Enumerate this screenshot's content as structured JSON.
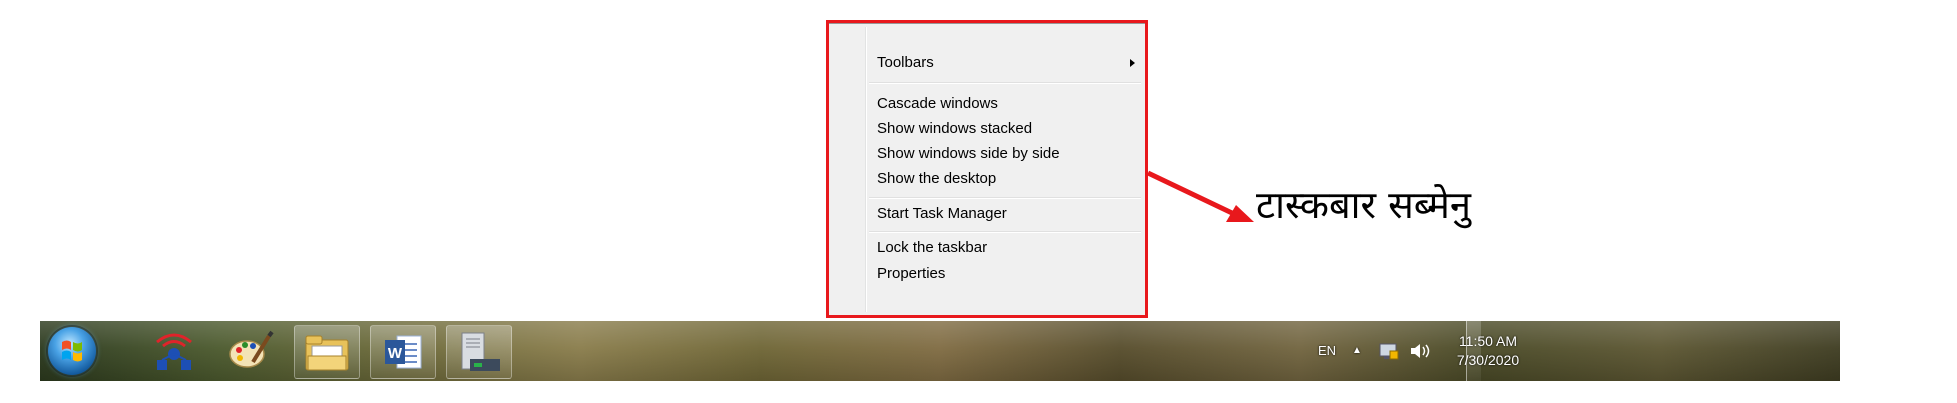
{
  "context_menu": {
    "items": {
      "toolbars": "Toolbars",
      "cascade": "Cascade windows",
      "stacked": "Show windows stacked",
      "side_by_side": "Show windows side by side",
      "desktop": "Show the desktop",
      "task_manager": "Start Task Manager",
      "lock": "Lock the taskbar",
      "properties": "Properties"
    }
  },
  "callout": {
    "label": "टास्कबार सब्मेनु",
    "color": "#e8181c"
  },
  "taskbar": {
    "pinned_icons": [
      "windows-start-orb",
      "network-app-icon",
      "paint-icon",
      "file-explorer-icon",
      "word-icon",
      "server-manager-icon"
    ]
  },
  "tray": {
    "language": "EN",
    "time": "11:50 AM",
    "date": "7/30/2020"
  }
}
